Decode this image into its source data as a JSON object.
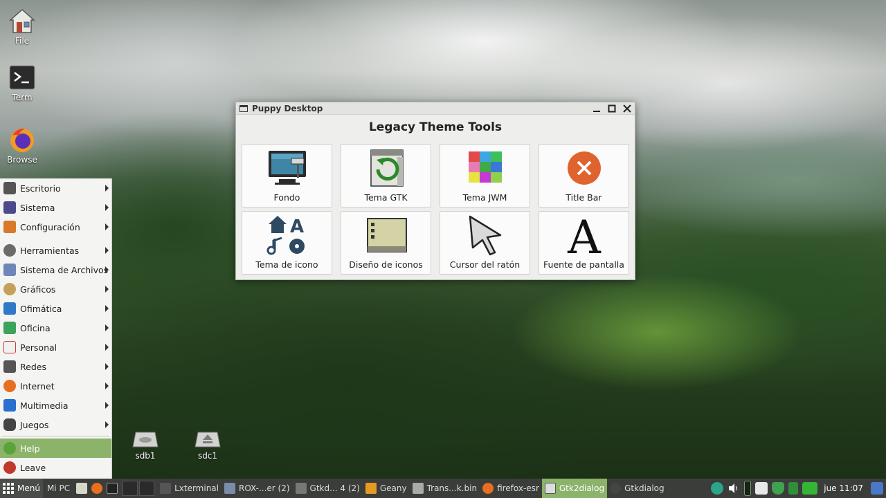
{
  "desktop": {
    "icons": [
      {
        "label": "File"
      },
      {
        "label": "Term"
      },
      {
        "label": "Browse"
      },
      {
        "label": "sdb1"
      },
      {
        "label": "sdc1"
      }
    ]
  },
  "menu": {
    "items": [
      {
        "label": "Escritorio",
        "icon": "x-icon",
        "color": "#555555"
      },
      {
        "label": "Sistema",
        "icon": "monitor-icon",
        "color": "#4b4b8c"
      },
      {
        "label": "Configuración",
        "icon": "settings-grid-icon",
        "color": "#d9772b"
      },
      {
        "label": "Herramientas",
        "icon": "gear-icon",
        "color": "#6b6b6b"
      },
      {
        "label": "Sistema de Archivos",
        "icon": "file-icon",
        "color": "#6e86b8"
      },
      {
        "label": "Gráficos",
        "icon": "palette-icon",
        "color": "#c6a05a"
      },
      {
        "label": "Ofimática",
        "icon": "writer-icon",
        "color": "#2f79c8"
      },
      {
        "label": "Oficina",
        "icon": "spreadsheet-icon",
        "color": "#3ba35a"
      },
      {
        "label": "Personal",
        "icon": "calendar-icon",
        "color": "#c8433b"
      },
      {
        "label": "Redes",
        "icon": "network-icon",
        "color": "#555555"
      },
      {
        "label": "Internet",
        "icon": "firefox-icon",
        "color": "#e76f1f"
      },
      {
        "label": "Multimedia",
        "icon": "play-icon",
        "color": "#2a6ecf"
      },
      {
        "label": "Juegos",
        "icon": "gamepad-icon",
        "color": "#444444"
      }
    ],
    "help": "Help",
    "leave": "Leave"
  },
  "window": {
    "title": "Puppy Desktop",
    "heading": "Legacy Theme Tools",
    "tiles": [
      {
        "label": "Fondo",
        "icon": "wallpaper-icon"
      },
      {
        "label": "Tema GTK",
        "icon": "gtk-theme-icon"
      },
      {
        "label": "Tema JWM",
        "icon": "jwm-theme-icon"
      },
      {
        "label": "Title Bar",
        "icon": "close-circle-icon"
      },
      {
        "label": "Tema de icono",
        "icon": "icon-theme-icon"
      },
      {
        "label": "Diseño de iconos",
        "icon": "icon-layout-icon"
      },
      {
        "label": "Cursor del ratón",
        "icon": "cursor-icon"
      },
      {
        "label": "Fuente de pantalla",
        "icon": "font-icon"
      }
    ]
  },
  "taskbar": {
    "menu_label": "Menú",
    "mypc_label": "Mi PC",
    "tasks": [
      {
        "label": "Lxterminal",
        "color": "#555555"
      },
      {
        "label": "ROX-...er (2)",
        "color": "#7a8ca8"
      },
      {
        "label": "Gtkd... 4 (2)",
        "color": "#777777"
      },
      {
        "label": "Geany",
        "color": "#e39b21"
      },
      {
        "label": "Trans...k.bin",
        "color": "#aaaaaa"
      },
      {
        "label": "firefox-esr",
        "color": "#e76f1f"
      },
      {
        "label": "Gtk2dialog",
        "color": "#dddddd",
        "active": true
      },
      {
        "label": "Gtkdialog",
        "color": "#444444"
      }
    ],
    "clock": "jue 11:07",
    "colors": {
      "accent": "#8bb36a",
      "bar": "#3b3d3b"
    }
  }
}
